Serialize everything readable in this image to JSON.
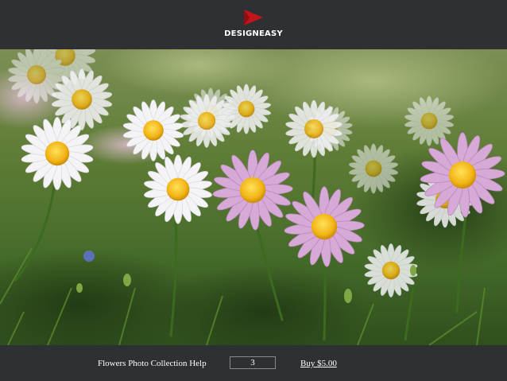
{
  "header": {
    "logo_icon": "red-triangle-flag-icon",
    "brand_name": "DESIGNEASY",
    "accent_color": "#c0161b"
  },
  "photo": {
    "subject_icon": "flower-photo-image"
  },
  "footer": {
    "help_label": "Flowers Photo Collection Help",
    "quantity_value": "3",
    "buy_label": "Buy $5.00"
  },
  "colors": {
    "bar_background": "#2f3033",
    "text": "#ffffff"
  }
}
